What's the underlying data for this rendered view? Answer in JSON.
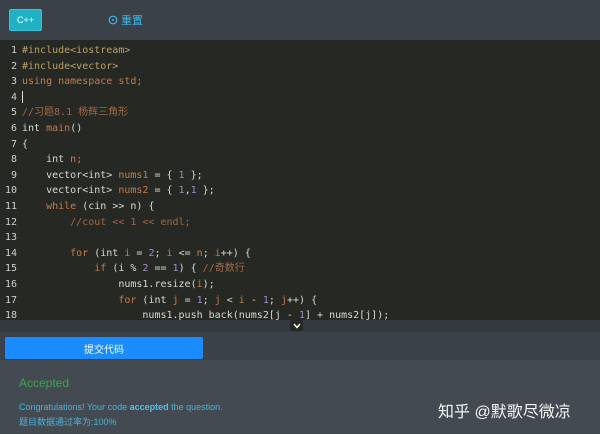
{
  "toolbar": {
    "language": "C++",
    "reset_label": "重置"
  },
  "editor": {
    "lines": [
      {
        "n": "1",
        "parts": [
          {
            "t": "#include<iostream>",
            "c": "str"
          }
        ]
      },
      {
        "n": "2",
        "parts": [
          {
            "t": "#include<vector>",
            "c": "str"
          }
        ]
      },
      {
        "n": "3",
        "parts": [
          {
            "t": "using namespace ",
            "c": "kw"
          },
          {
            "t": "std;",
            "c": "kw"
          }
        ]
      },
      {
        "n": "4",
        "parts": [],
        "cursor": true
      },
      {
        "n": "5",
        "parts": [
          {
            "t": "//习题8.1 杨辉三角形",
            "c": "cm"
          }
        ]
      },
      {
        "n": "6",
        "parts": [
          {
            "t": "int ",
            "c": ""
          },
          {
            "t": "main",
            "c": "kw"
          },
          {
            "t": "()",
            "c": ""
          }
        ]
      },
      {
        "n": "7",
        "parts": [
          {
            "t": "{",
            "c": ""
          }
        ]
      },
      {
        "n": "8",
        "parts": [
          {
            "t": "    int ",
            "c": ""
          },
          {
            "t": "n;",
            "c": "kw"
          }
        ]
      },
      {
        "n": "9",
        "parts": [
          {
            "t": "    vector<int> ",
            "c": ""
          },
          {
            "t": "nums1",
            "c": "kw"
          },
          {
            "t": " = { ",
            "c": ""
          },
          {
            "t": "1",
            "c": "num"
          },
          {
            "t": " };",
            "c": ""
          }
        ]
      },
      {
        "n": "10",
        "parts": [
          {
            "t": "    vector<int> ",
            "c": ""
          },
          {
            "t": "nums2",
            "c": "kw"
          },
          {
            "t": " = { ",
            "c": ""
          },
          {
            "t": "1",
            "c": "num"
          },
          {
            "t": ",",
            "c": ""
          },
          {
            "t": "1",
            "c": "num"
          },
          {
            "t": " };",
            "c": ""
          }
        ]
      },
      {
        "n": "11",
        "parts": [
          {
            "t": "    while ",
            "c": "kw"
          },
          {
            "t": "(cin >> n) {",
            "c": ""
          }
        ]
      },
      {
        "n": "12",
        "parts": [
          {
            "t": "        //cout << 1 << endl;",
            "c": "cm"
          }
        ]
      },
      {
        "n": "13",
        "parts": []
      },
      {
        "n": "14",
        "parts": [
          {
            "t": "        for ",
            "c": "kw"
          },
          {
            "t": "(int ",
            "c": ""
          },
          {
            "t": "i",
            "c": "kw"
          },
          {
            "t": " = ",
            "c": ""
          },
          {
            "t": "2",
            "c": "num"
          },
          {
            "t": "; ",
            "c": ""
          },
          {
            "t": "i",
            "c": "kw"
          },
          {
            "t": " <= ",
            "c": ""
          },
          {
            "t": "n",
            "c": "kw"
          },
          {
            "t": "; ",
            "c": ""
          },
          {
            "t": "i",
            "c": "kw"
          },
          {
            "t": "++) {",
            "c": ""
          }
        ]
      },
      {
        "n": "15",
        "parts": [
          {
            "t": "            if ",
            "c": "kw"
          },
          {
            "t": "(i % ",
            "c": ""
          },
          {
            "t": "2",
            "c": "num"
          },
          {
            "t": " == ",
            "c": ""
          },
          {
            "t": "1",
            "c": "num"
          },
          {
            "t": ") { ",
            "c": ""
          },
          {
            "t": "//奇数行",
            "c": "cm"
          }
        ]
      },
      {
        "n": "16",
        "parts": [
          {
            "t": "                nums1.resize(",
            "c": ""
          },
          {
            "t": "i",
            "c": "kw"
          },
          {
            "t": ");",
            "c": ""
          }
        ]
      },
      {
        "n": "17",
        "parts": [
          {
            "t": "                for ",
            "c": "kw"
          },
          {
            "t": "(int ",
            "c": ""
          },
          {
            "t": "j",
            "c": "kw"
          },
          {
            "t": " = ",
            "c": ""
          },
          {
            "t": "1",
            "c": "num"
          },
          {
            "t": "; ",
            "c": ""
          },
          {
            "t": "j",
            "c": "kw"
          },
          {
            "t": " < ",
            "c": ""
          },
          {
            "t": "i",
            "c": "kw"
          },
          {
            "t": " - ",
            "c": ""
          },
          {
            "t": "1",
            "c": "num"
          },
          {
            "t": "; ",
            "c": ""
          },
          {
            "t": "j",
            "c": "kw"
          },
          {
            "t": "++) {",
            "c": ""
          }
        ]
      },
      {
        "n": "18",
        "parts": [
          {
            "t": "                    nums1.push_back(nums2[j - ",
            "c": ""
          },
          {
            "t": "1",
            "c": "num"
          },
          {
            "t": "] + nums2[j]);",
            "c": ""
          }
        ]
      }
    ]
  },
  "submit_label": "提交代码",
  "result": {
    "status": "Accepted",
    "congrats_prefix": "Congratulations!   Your code ",
    "congrats_bold": "accepted",
    "congrats_suffix": " the question.",
    "pass_rate": "题目数据通过率为:100%"
  },
  "watermark": "知乎 @默歌尽微凉"
}
